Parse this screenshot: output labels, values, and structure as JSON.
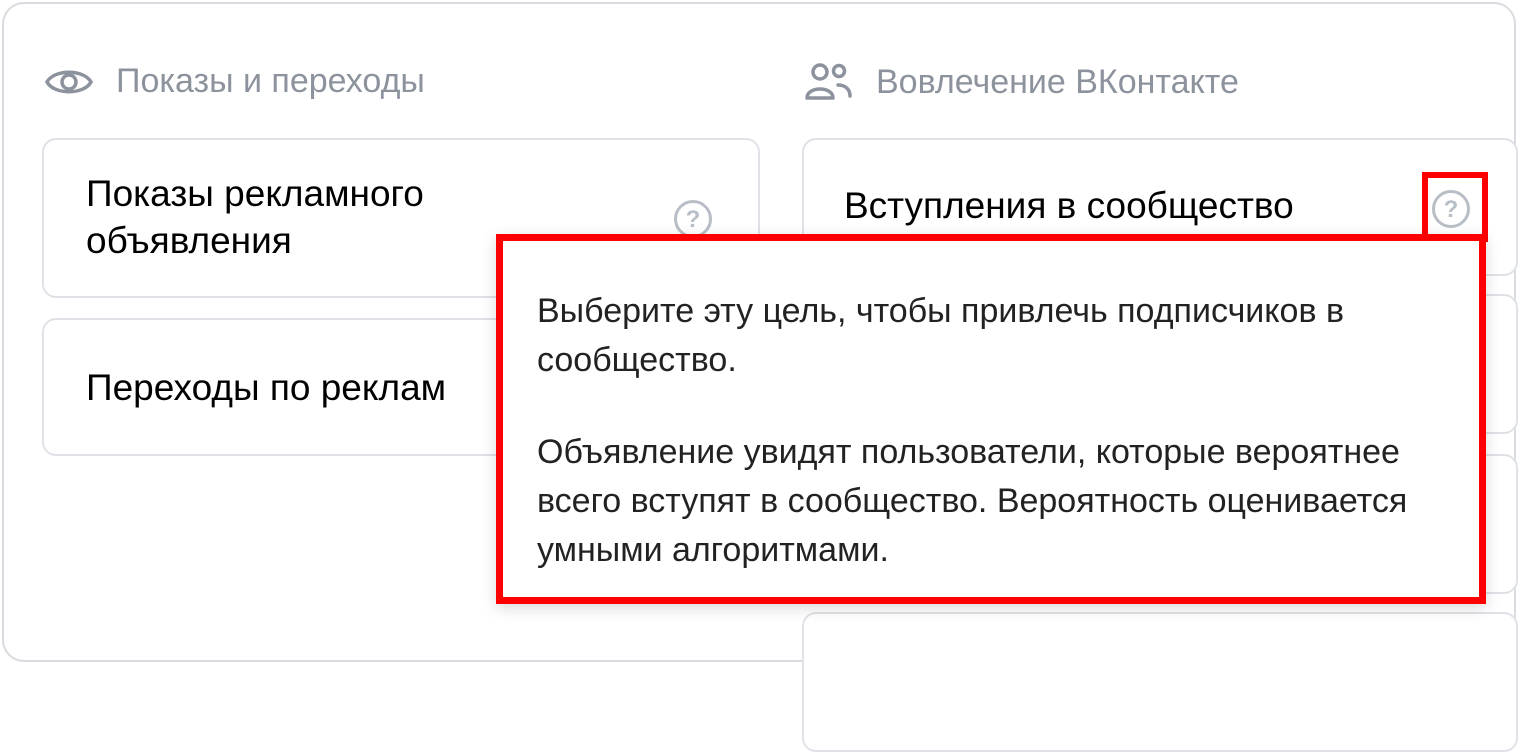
{
  "sections": {
    "left": {
      "icon": "eye-icon",
      "title": "Показы и переходы"
    },
    "right": {
      "icon": "users-icon",
      "title": "Вовлечение ВКонтакте"
    }
  },
  "left_cards": [
    {
      "label": "Показы рекламного объявления",
      "help": "?"
    },
    {
      "label": "Переходы по реклам"
    }
  ],
  "right_cards": [
    {
      "label": "Вступления в сообщество",
      "help": "?"
    }
  ],
  "tooltip": {
    "paragraph1": "Выберите эту цель, чтобы привлечь подписчиков в сообщество.",
    "paragraph2": "Объявление увидят пользователи, которые вероятнее всего вступят в сообщество. Вероятность оценивается умными алгоритмами."
  },
  "colors": {
    "highlight": "#ff0000",
    "muted_text": "#8c939d",
    "border": "#dfe2e7"
  }
}
